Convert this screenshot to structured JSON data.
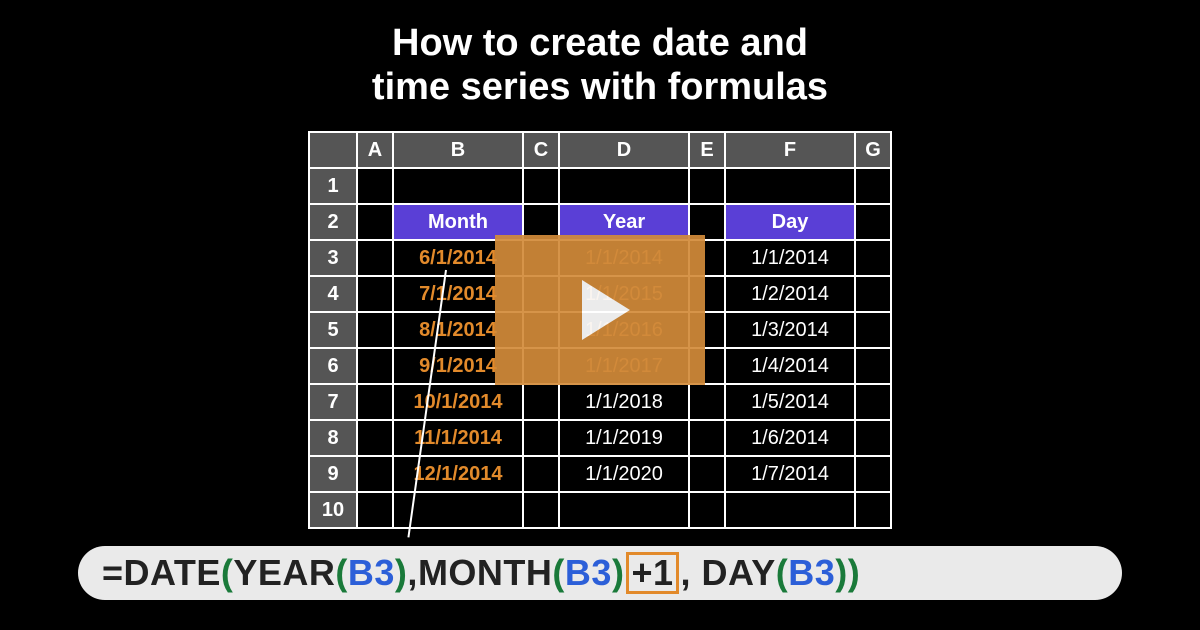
{
  "title_line1": "How to create date and",
  "title_line2": "time series with formulas",
  "columns": {
    "A": "A",
    "B": "B",
    "C": "C",
    "D": "D",
    "E": "E",
    "F": "F",
    "G": "G"
  },
  "row_nums": [
    "1",
    "2",
    "3",
    "4",
    "5",
    "6",
    "7",
    "8",
    "9",
    "10"
  ],
  "headers": {
    "b": "Month",
    "d": "Year",
    "f": "Day"
  },
  "rows": [
    {
      "b": "6/1/2014",
      "d": "1/1/2014",
      "f": "1/1/2014",
      "d_sel": true
    },
    {
      "b": "7/1/2014",
      "d": "1/1/2015",
      "f": "1/2/2014",
      "d_sel": true
    },
    {
      "b": "8/1/2014",
      "d": "1/1/2016",
      "f": "1/3/2014",
      "d_sel": true
    },
    {
      "b": "9/1/2014",
      "d": "1/1/2017",
      "f": "1/4/2014",
      "d_sel": true
    },
    {
      "b": "10/1/2014",
      "d": "1/1/2018",
      "f": "1/5/2014",
      "d_sel": false
    },
    {
      "b": "11/1/2014",
      "d": "1/1/2019",
      "f": "1/6/2014",
      "d_sel": false
    },
    {
      "b": "12/1/2014",
      "d": "1/1/2020",
      "f": "1/7/2014",
      "d_sel": false
    }
  ],
  "formula": {
    "eq": "=",
    "date": "DATE",
    "op": "(",
    "year": "YEAR",
    "op2": "(",
    "ref1": "B3",
    "cp": ")",
    "comma": ",",
    "month": "MONTH",
    "ref2": "B3",
    "plus1": "+1",
    "comma2": ",",
    "sp": " ",
    "day": "DAY",
    "ref3": "B3",
    "cp2": ")",
    "cp3": ")"
  }
}
